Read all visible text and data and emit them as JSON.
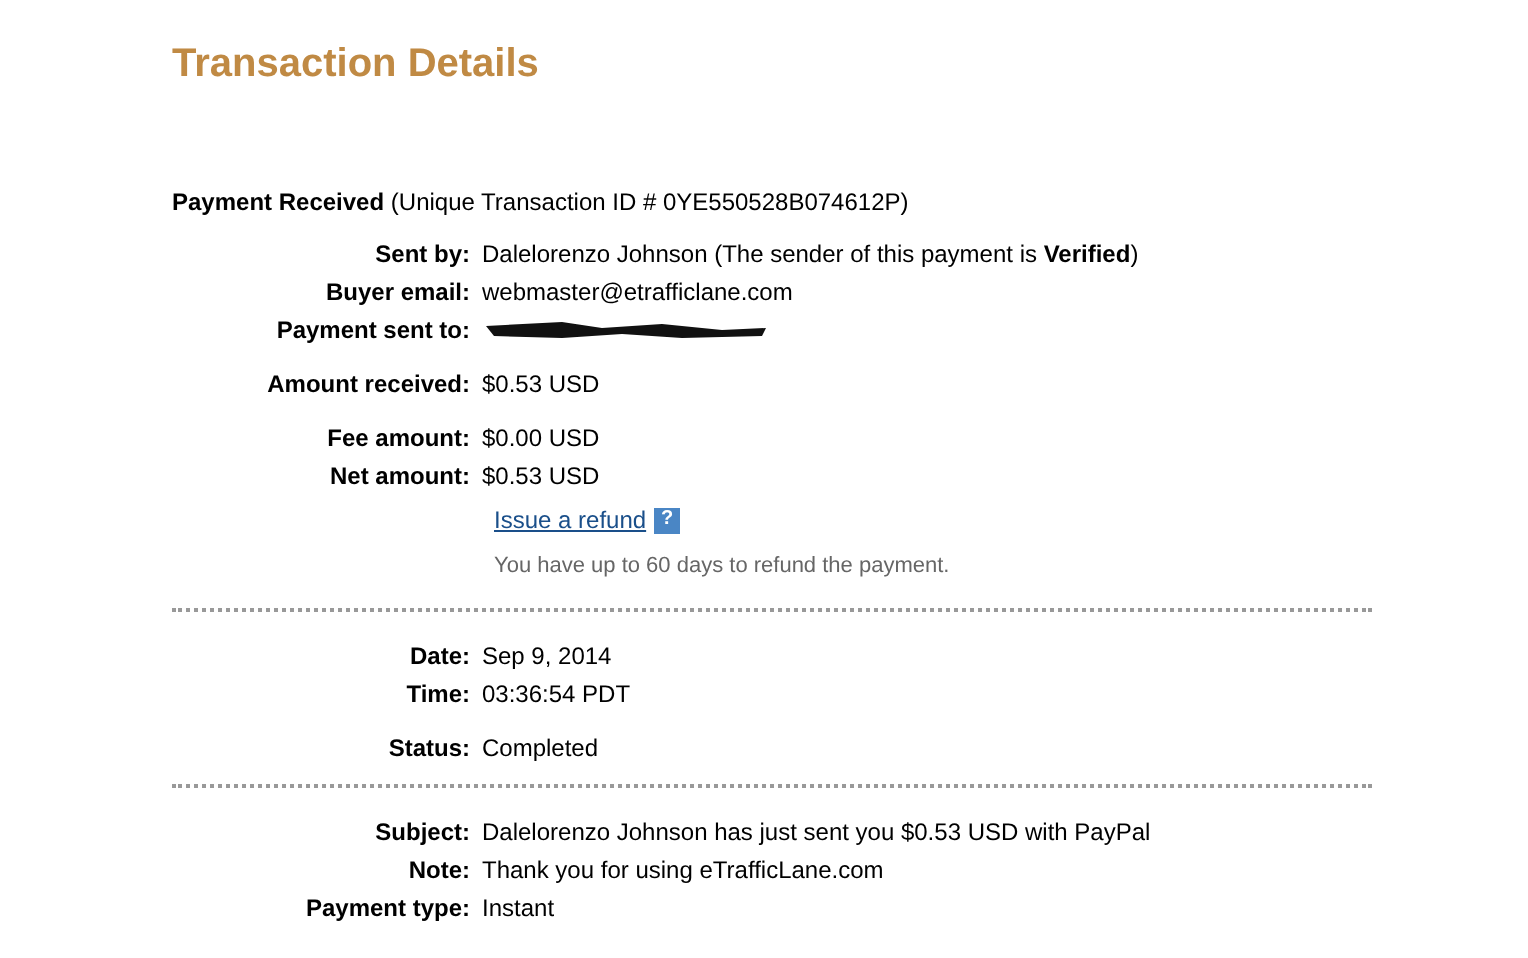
{
  "title": "Transaction Details",
  "summary": {
    "label": "Payment Received",
    "detail": "(Unique Transaction ID # 0YE550528B074612P)"
  },
  "sections": [
    {
      "groups": [
        [
          {
            "label": "Sent by:",
            "kind": "text",
            "value": "Dalelorenzo Johnson (The sender of this payment is **Verified**)"
          },
          {
            "label": "Buyer email:",
            "kind": "text",
            "value": "webmaster@etrafficlane.com"
          },
          {
            "label": "Payment sent to:",
            "kind": "redacted"
          }
        ],
        [
          {
            "label": "Amount received:",
            "kind": "text",
            "value": "$0.53 USD"
          }
        ],
        [
          {
            "label": "Fee amount:",
            "kind": "text",
            "value": "$0.00 USD"
          },
          {
            "label": "Net amount:",
            "kind": "text",
            "value": "$0.53 USD"
          }
        ]
      ],
      "refund": {
        "link": "Issue a refund",
        "help": "?",
        "note": "You have up to 60 days to refund the payment."
      }
    },
    {
      "groups": [
        [
          {
            "label": "Date:",
            "kind": "text",
            "value": "Sep 9, 2014"
          },
          {
            "label": "Time:",
            "kind": "text",
            "value": "03:36:54 PDT"
          }
        ],
        [
          {
            "label": "Status:",
            "kind": "text",
            "value": "Completed"
          }
        ]
      ]
    },
    {
      "groups": [
        [
          {
            "label": "Subject:",
            "kind": "text",
            "value": "Dalelorenzo Johnson has just sent you $0.53 USD with PayPal"
          },
          {
            "label": "Note:",
            "kind": "text",
            "value": "Thank you for using eTrafficLane.com"
          },
          {
            "label": "Payment type:",
            "kind": "text",
            "value": "Instant"
          }
        ]
      ]
    }
  ]
}
